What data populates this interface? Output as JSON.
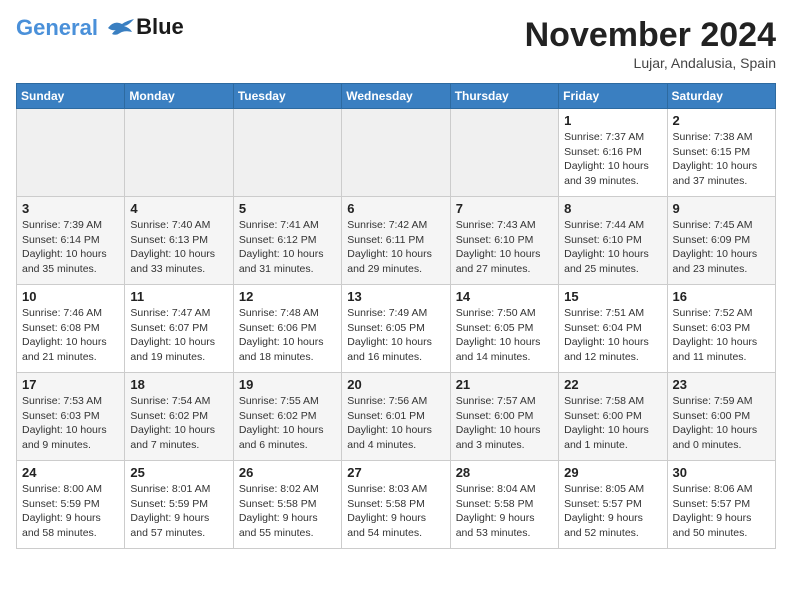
{
  "header": {
    "logo_line1": "General",
    "logo_line2": "Blue",
    "month_title": "November 2024",
    "location": "Lujar, Andalusia, Spain"
  },
  "weekdays": [
    "Sunday",
    "Monday",
    "Tuesday",
    "Wednesday",
    "Thursday",
    "Friday",
    "Saturday"
  ],
  "weeks": [
    [
      {
        "day": "",
        "info": ""
      },
      {
        "day": "",
        "info": ""
      },
      {
        "day": "",
        "info": ""
      },
      {
        "day": "",
        "info": ""
      },
      {
        "day": "",
        "info": ""
      },
      {
        "day": "1",
        "info": "Sunrise: 7:37 AM\nSunset: 6:16 PM\nDaylight: 10 hours and 39 minutes."
      },
      {
        "day": "2",
        "info": "Sunrise: 7:38 AM\nSunset: 6:15 PM\nDaylight: 10 hours and 37 minutes."
      }
    ],
    [
      {
        "day": "3",
        "info": "Sunrise: 7:39 AM\nSunset: 6:14 PM\nDaylight: 10 hours and 35 minutes."
      },
      {
        "day": "4",
        "info": "Sunrise: 7:40 AM\nSunset: 6:13 PM\nDaylight: 10 hours and 33 minutes."
      },
      {
        "day": "5",
        "info": "Sunrise: 7:41 AM\nSunset: 6:12 PM\nDaylight: 10 hours and 31 minutes."
      },
      {
        "day": "6",
        "info": "Sunrise: 7:42 AM\nSunset: 6:11 PM\nDaylight: 10 hours and 29 minutes."
      },
      {
        "day": "7",
        "info": "Sunrise: 7:43 AM\nSunset: 6:10 PM\nDaylight: 10 hours and 27 minutes."
      },
      {
        "day": "8",
        "info": "Sunrise: 7:44 AM\nSunset: 6:10 PM\nDaylight: 10 hours and 25 minutes."
      },
      {
        "day": "9",
        "info": "Sunrise: 7:45 AM\nSunset: 6:09 PM\nDaylight: 10 hours and 23 minutes."
      }
    ],
    [
      {
        "day": "10",
        "info": "Sunrise: 7:46 AM\nSunset: 6:08 PM\nDaylight: 10 hours and 21 minutes."
      },
      {
        "day": "11",
        "info": "Sunrise: 7:47 AM\nSunset: 6:07 PM\nDaylight: 10 hours and 19 minutes."
      },
      {
        "day": "12",
        "info": "Sunrise: 7:48 AM\nSunset: 6:06 PM\nDaylight: 10 hours and 18 minutes."
      },
      {
        "day": "13",
        "info": "Sunrise: 7:49 AM\nSunset: 6:05 PM\nDaylight: 10 hours and 16 minutes."
      },
      {
        "day": "14",
        "info": "Sunrise: 7:50 AM\nSunset: 6:05 PM\nDaylight: 10 hours and 14 minutes."
      },
      {
        "day": "15",
        "info": "Sunrise: 7:51 AM\nSunset: 6:04 PM\nDaylight: 10 hours and 12 minutes."
      },
      {
        "day": "16",
        "info": "Sunrise: 7:52 AM\nSunset: 6:03 PM\nDaylight: 10 hours and 11 minutes."
      }
    ],
    [
      {
        "day": "17",
        "info": "Sunrise: 7:53 AM\nSunset: 6:03 PM\nDaylight: 10 hours and 9 minutes."
      },
      {
        "day": "18",
        "info": "Sunrise: 7:54 AM\nSunset: 6:02 PM\nDaylight: 10 hours and 7 minutes."
      },
      {
        "day": "19",
        "info": "Sunrise: 7:55 AM\nSunset: 6:02 PM\nDaylight: 10 hours and 6 minutes."
      },
      {
        "day": "20",
        "info": "Sunrise: 7:56 AM\nSunset: 6:01 PM\nDaylight: 10 hours and 4 minutes."
      },
      {
        "day": "21",
        "info": "Sunrise: 7:57 AM\nSunset: 6:00 PM\nDaylight: 10 hours and 3 minutes."
      },
      {
        "day": "22",
        "info": "Sunrise: 7:58 AM\nSunset: 6:00 PM\nDaylight: 10 hours and 1 minute."
      },
      {
        "day": "23",
        "info": "Sunrise: 7:59 AM\nSunset: 6:00 PM\nDaylight: 10 hours and 0 minutes."
      }
    ],
    [
      {
        "day": "24",
        "info": "Sunrise: 8:00 AM\nSunset: 5:59 PM\nDaylight: 9 hours and 58 minutes."
      },
      {
        "day": "25",
        "info": "Sunrise: 8:01 AM\nSunset: 5:59 PM\nDaylight: 9 hours and 57 minutes."
      },
      {
        "day": "26",
        "info": "Sunrise: 8:02 AM\nSunset: 5:58 PM\nDaylight: 9 hours and 55 minutes."
      },
      {
        "day": "27",
        "info": "Sunrise: 8:03 AM\nSunset: 5:58 PM\nDaylight: 9 hours and 54 minutes."
      },
      {
        "day": "28",
        "info": "Sunrise: 8:04 AM\nSunset: 5:58 PM\nDaylight: 9 hours and 53 minutes."
      },
      {
        "day": "29",
        "info": "Sunrise: 8:05 AM\nSunset: 5:57 PM\nDaylight: 9 hours and 52 minutes."
      },
      {
        "day": "30",
        "info": "Sunrise: 8:06 AM\nSunset: 5:57 PM\nDaylight: 9 hours and 50 minutes."
      }
    ]
  ]
}
